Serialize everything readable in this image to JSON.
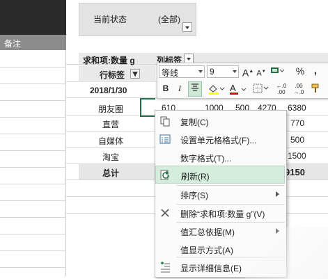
{
  "left_column": {
    "header": "备注"
  },
  "filter": {
    "label": "当前状态",
    "value": "(全部)"
  },
  "pivot": {
    "sum_label": "求和项:数量 g",
    "col_label": "列标签",
    "row_label": "行标签",
    "date": "2018/1/30",
    "rows": [
      {
        "name": "朋友圈",
        "values": [
          "610",
          "1000",
          "500",
          "4270",
          "6380"
        ]
      },
      {
        "name": "直营",
        "values": [
          "770"
        ]
      },
      {
        "name": "自媒体",
        "values": [
          "500"
        ]
      },
      {
        "name": "淘宝",
        "values": [
          "1500"
        ]
      }
    ],
    "total_label": "总计",
    "total_value": "9150"
  },
  "mini_toolbar": {
    "font_name": "等线",
    "font_size": "9",
    "grow_font": "A",
    "shrink_font": "A",
    "percent": "%",
    "comma": ",",
    "bold": "B",
    "italic": "I",
    "font_color_letter": "A",
    "decimal_increase": "←.0 .00",
    "decimal_decrease": ".00 →.0",
    "accent_green": "#1e7145",
    "fill_yellow": "#ffff00",
    "font_red": "#e00000"
  },
  "context_menu": {
    "items": [
      {
        "label": "复制(C)",
        "icon": "copy-icon"
      },
      {
        "label": "设置单元格格式(F)...",
        "icon": "format-cells-icon"
      },
      {
        "label": "数字格式(T)...",
        "icon": ""
      },
      {
        "label": "刷新(R)",
        "icon": "refresh-icon"
      },
      {
        "label": "排序(S)",
        "icon": ""
      },
      {
        "label": "删除“求和项:数量 g”(V)",
        "icon": "close-icon"
      },
      {
        "label": "值汇总依据(M)",
        "icon": ""
      },
      {
        "label": "值显示方式(A)",
        "icon": ""
      },
      {
        "label": "显示详细信息(E)",
        "icon": "expand-details-icon"
      }
    ]
  }
}
